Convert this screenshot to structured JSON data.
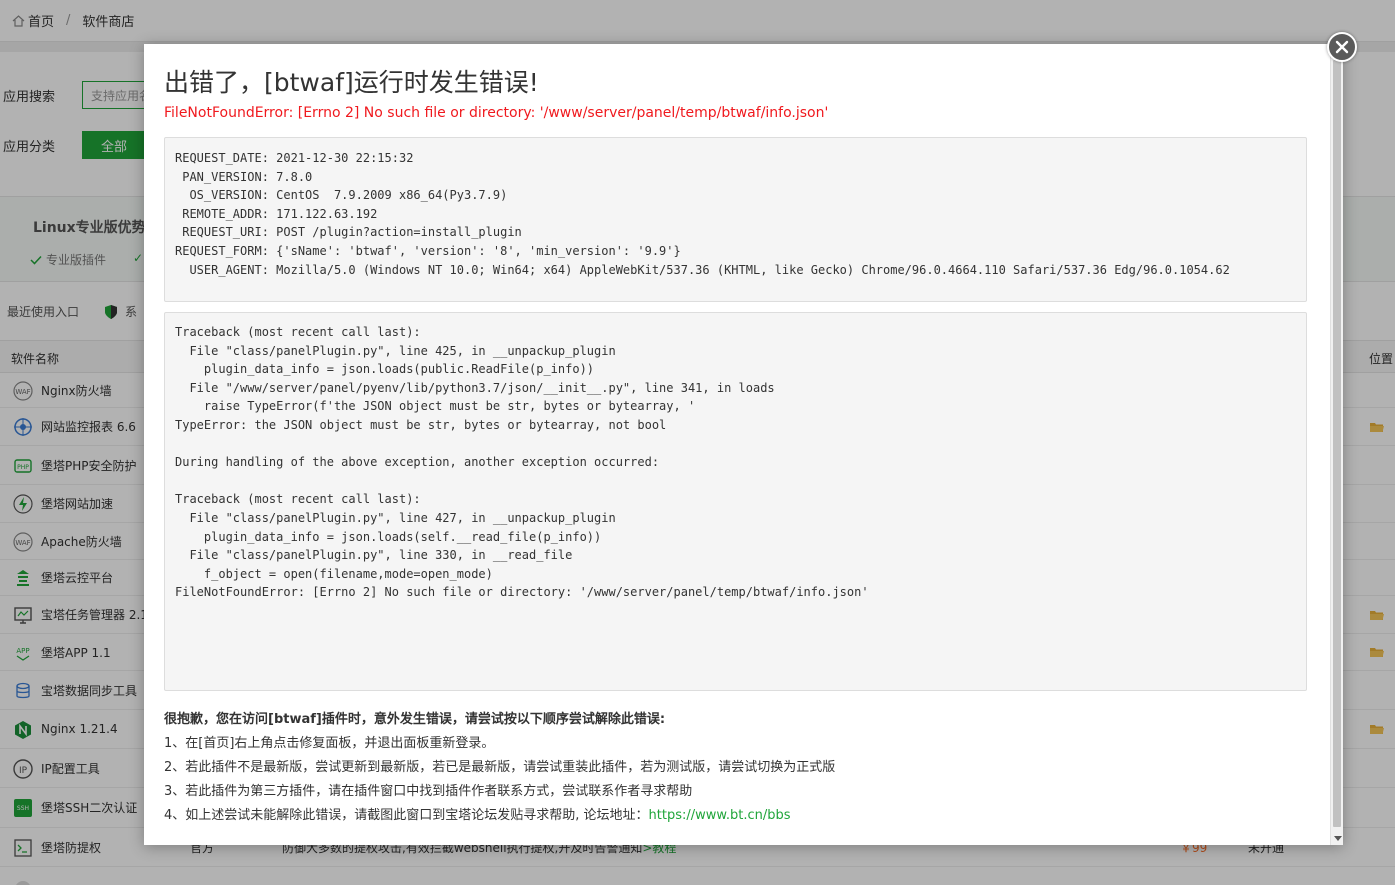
{
  "breadcrumb": {
    "home": "首页",
    "separator": "/",
    "current": "软件商店"
  },
  "filters": {
    "search_label": "应用搜索",
    "search_placeholder": "支持应用名",
    "category_label": "应用分类",
    "category_active": "全部"
  },
  "promo": {
    "title": "Linux专业版优势",
    "feature1": "专业版插件",
    "feature2": "✓"
  },
  "recent": {
    "label": "最近使用入口",
    "item": "系"
  },
  "table": {
    "col_name": "软件名称",
    "col_location": "位置",
    "rows": [
      {
        "name": "Nginx防火墙",
        "icon": "waf-icon",
        "folder": false
      },
      {
        "name": "网站监控报表 6.6",
        "icon": "monitor-icon",
        "folder": true
      },
      {
        "name": "堡塔PHP安全防护",
        "icon": "php-shield-icon",
        "folder": false
      },
      {
        "name": "堡塔网站加速",
        "icon": "lightning-icon",
        "folder": false
      },
      {
        "name": "Apache防火墙",
        "icon": "waf-icon",
        "folder": false
      },
      {
        "name": "堡塔云控平台",
        "icon": "tower-icon",
        "folder": false
      },
      {
        "name": "宝塔任务管理器 2.1",
        "icon": "task-manager-icon",
        "folder": true
      },
      {
        "name": "堡塔APP 1.1",
        "icon": "app-icon",
        "folder": true
      },
      {
        "name": "宝塔数据同步工具",
        "icon": "database-icon",
        "folder": false
      },
      {
        "name": "Nginx 1.21.4",
        "icon": "nginx-icon",
        "folder": true
      },
      {
        "name": "IP配置工具",
        "icon": "ip-icon",
        "folder": false
      },
      {
        "name": "堡塔SSH二次认证",
        "icon": "ssh-icon",
        "folder": false
      },
      {
        "name": "堡塔防提权",
        "icon": "terminal-icon",
        "folder": false
      }
    ],
    "last_row": {
      "developer": "官方",
      "desc": "防御大多数的提权攻击,有效拦截webshell执行提权,开及时告警通知",
      "desc_link": ">教程",
      "price": "￥99",
      "status": "未开通"
    }
  },
  "modal": {
    "title": "出错了，[btwaf]运行时发生错误!",
    "error_message": "FileNotFoundError: [Errno 2] No such file or directory: '/www/server/panel/temp/btwaf/info.json'",
    "request_lines": [
      "REQUEST_DATE: 2021-12-30 22:15:32",
      " PAN_VERSION: 7.8.0",
      "  OS_VERSION: CentOS  7.9.2009 x86_64(Py3.7.9)",
      " REMOTE_ADDR: 171.122.63.192",
      " REQUEST_URI: POST /plugin?action=install_plugin",
      "REQUEST_FORM: {'sName': 'btwaf', 'version': '8', 'min_version': '9.9'}",
      "  USER_AGENT: Mozilla/5.0 (Windows NT 10.0; Win64; x64) AppleWebKit/537.36 (KHTML, like Gecko) Chrome/96.0.4664.110 Safari/537.36 Edg/96.0.1054.62"
    ],
    "traceback_lines": [
      "Traceback (most recent call last):",
      "  File \"class/panelPlugin.py\", line 425, in __unpackup_plugin",
      "    plugin_data_info = json.loads(public.ReadFile(p_info))",
      "  File \"/www/server/panel/pyenv/lib/python3.7/json/__init__.py\", line 341, in loads",
      "    raise TypeError(f'the JSON object must be str, bytes or bytearray, '",
      "TypeError: the JSON object must be str, bytes or bytearray, not bool",
      "",
      "During handling of the above exception, another exception occurred:",
      "",
      "Traceback (most recent call last):",
      "  File \"class/panelPlugin.py\", line 427, in __unpackup_plugin",
      "    plugin_data_info = json.loads(self.__read_file(p_info))",
      "  File \"class/panelPlugin.py\", line 330, in __read_file",
      "    f_object = open(filename,mode=open_mode)",
      "FileNotFoundError: [Errno 2] No such file or directory: '/www/server/panel/temp/btwaf/info.json'"
    ],
    "help_heading": "很抱歉，您在访问[btwaf]插件时，意外发生错误，请尝试按以下顺序尝试解除此错误:",
    "help_steps": [
      "1、在[首页]右上角点击修复面板，并退出面板重新登录。",
      "2、若此插件不是最新版，尝试更新到最新版，若已是最新版，请尝试重装此插件，若为测试版，请尝试切换为正式版",
      "3、若此插件为第三方插件，请在插件窗口中找到插件作者联系方式，尝试联系作者寻求帮助"
    ],
    "help_step4_prefix": "4、如上述尝试未能解除此错误，请截图此窗口到宝塔论坛发贴寻求帮助, 论坛地址：",
    "help_step4_link": "https://www.bt.cn/bbs"
  },
  "colors": {
    "accent": "#20a53a",
    "error": "#f0191e",
    "price": "#fc6d26"
  }
}
